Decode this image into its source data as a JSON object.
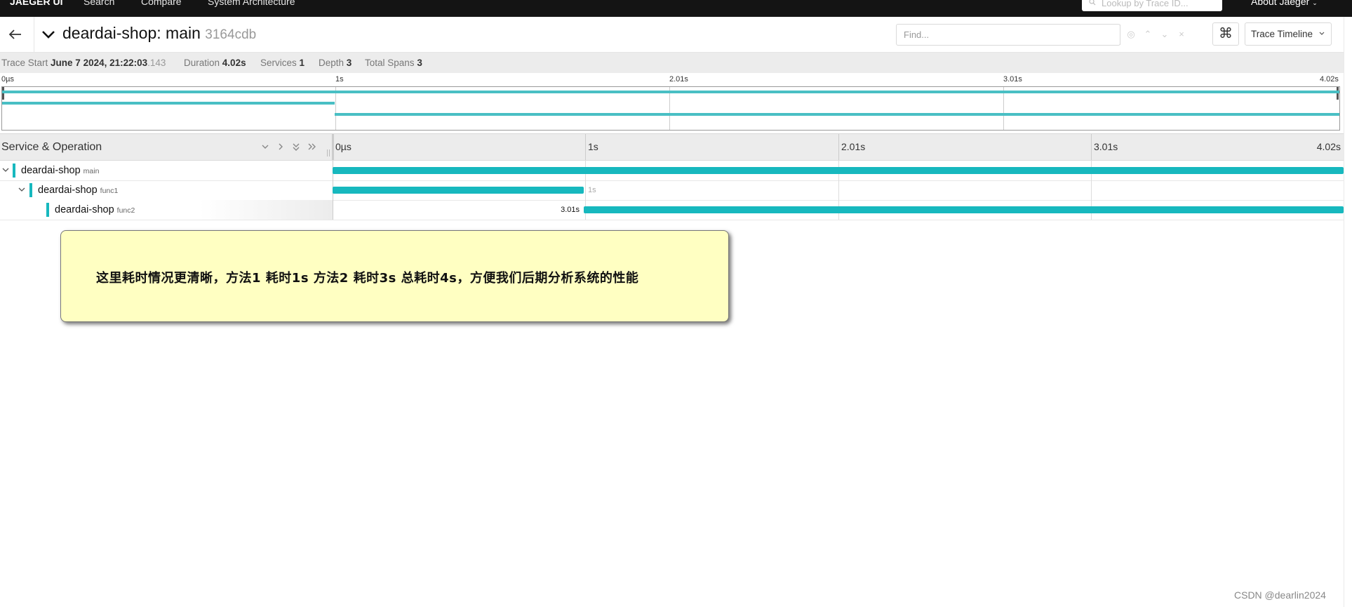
{
  "nav": {
    "brand": "JAEGER UI",
    "items": [
      "Search",
      "Compare",
      "System Architecture"
    ],
    "lookup_placeholder": "Lookup by Trace ID...",
    "about": "About Jaeger"
  },
  "trace": {
    "service": "deardai-shop: main",
    "id": "3164cdb",
    "find_placeholder": "Find...",
    "view_mode": "Trace Timeline"
  },
  "summary": {
    "trace_start_label": "Trace Start",
    "trace_start_value": "June 7 2024, 21:22:03",
    "trace_start_ms": ".143",
    "duration_label": "Duration",
    "duration_value": "4.02s",
    "services_label": "Services",
    "services_value": "1",
    "depth_label": "Depth",
    "depth_value": "3",
    "total_spans_label": "Total Spans",
    "total_spans_value": "3"
  },
  "timeline": {
    "total_duration_s": 4.02,
    "ticks": [
      "0µs",
      "1s",
      "2.01s",
      "3.01s",
      "4.02s"
    ]
  },
  "span_header": {
    "label": "Service & Operation"
  },
  "spans": [
    {
      "service": "deardai-shop",
      "operation": "main",
      "start_s": 0,
      "duration_s": 4.02,
      "depth": 0,
      "label": ""
    },
    {
      "service": "deardai-shop",
      "operation": "func1",
      "start_s": 0,
      "duration_s": 1.0,
      "depth": 1,
      "label": "1s"
    },
    {
      "service": "deardai-shop",
      "operation": "func2",
      "start_s": 1.0,
      "duration_s": 3.02,
      "depth": 2,
      "label": "3.01s"
    }
  ],
  "colors": {
    "span": "#17b8be",
    "minimap_span": "#49bfc4",
    "callout_bg": "#ffffc2"
  },
  "annotation": "这里耗时情况更清晰，方法1 耗时1s 方法2 耗时3s  总耗时4s，方便我们后期分析系统的性能",
  "watermark": "CSDN @dearlin2024"
}
